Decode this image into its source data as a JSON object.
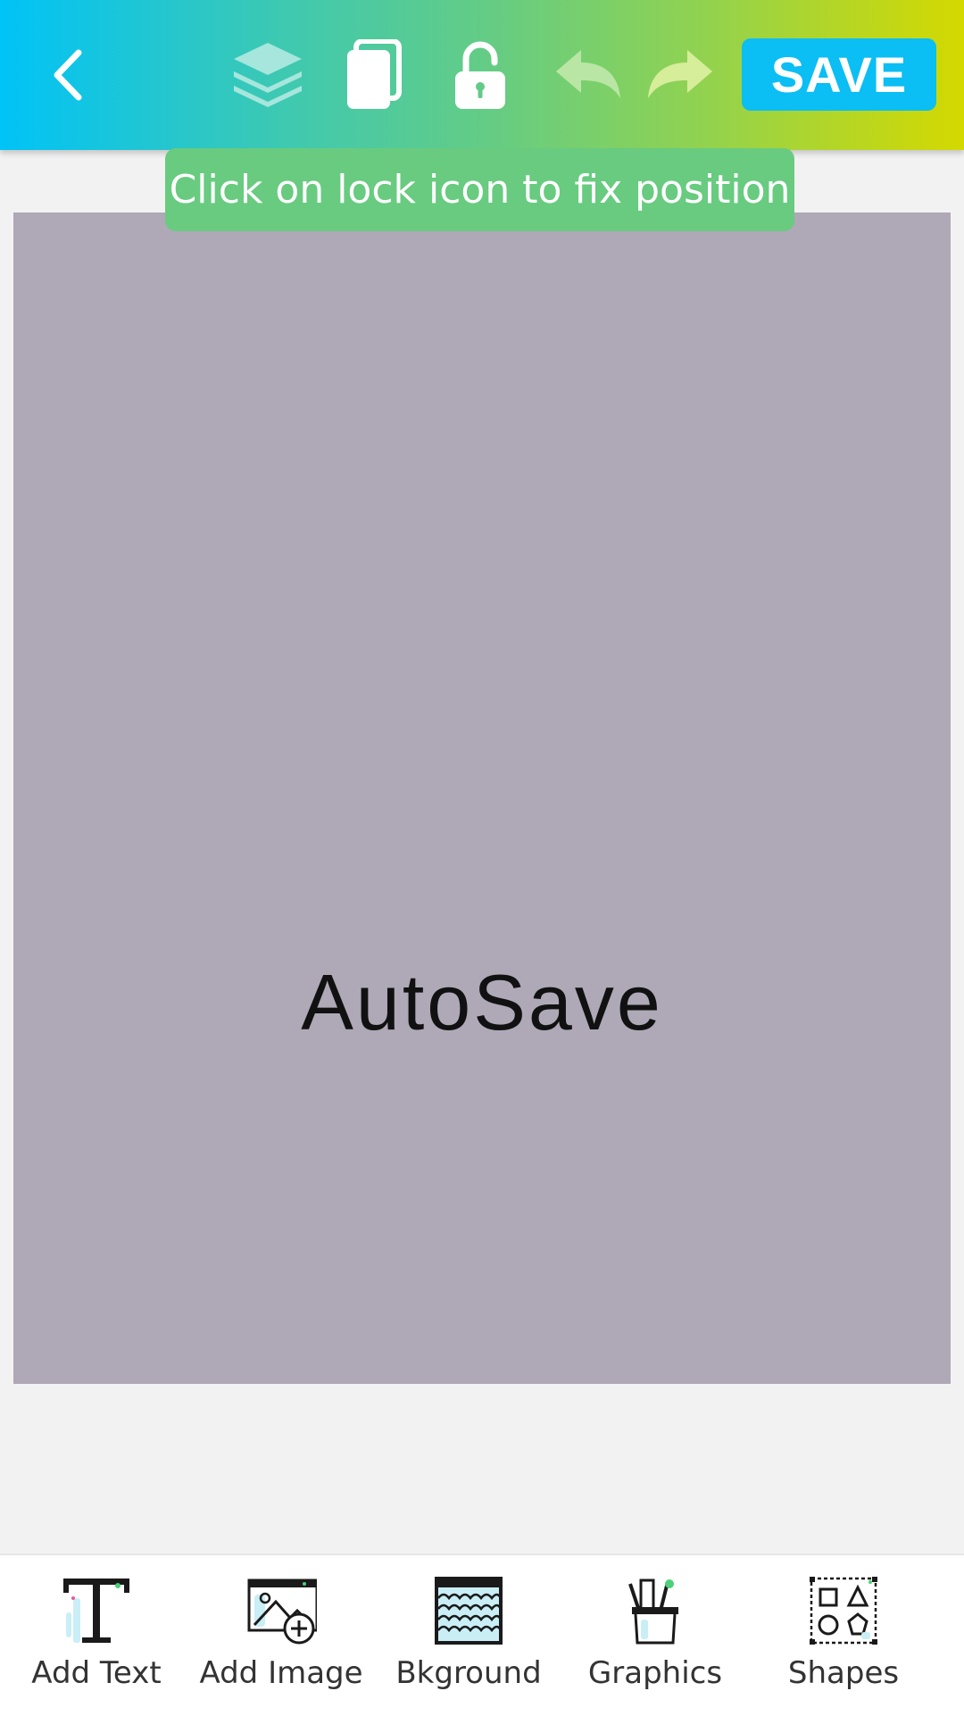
{
  "toolbar": {
    "back_icon": "chevron-left-icon",
    "layers_icon": "layers-icon",
    "copy_icon": "copy-icon",
    "lock_icon": "unlock-icon",
    "undo_icon": "undo-icon",
    "redo_icon": "redo-icon",
    "save_label": "SAVE"
  },
  "tooltip": {
    "text": "Click on lock icon to fix position"
  },
  "canvas": {
    "text": "AutoSave",
    "background": "#afa8b7"
  },
  "bottom_tools": [
    {
      "label": "Add Text",
      "icon": "text-icon"
    },
    {
      "label": "Add Image",
      "icon": "add-image-icon"
    },
    {
      "label": "Bkground",
      "icon": "background-pattern-icon"
    },
    {
      "label": "Graphics",
      "icon": "pencil-cup-icon"
    },
    {
      "label": "Shapes",
      "icon": "shapes-icon"
    }
  ],
  "colors": {
    "accent": "#0bbef3",
    "tooltip": "#68cb80"
  }
}
